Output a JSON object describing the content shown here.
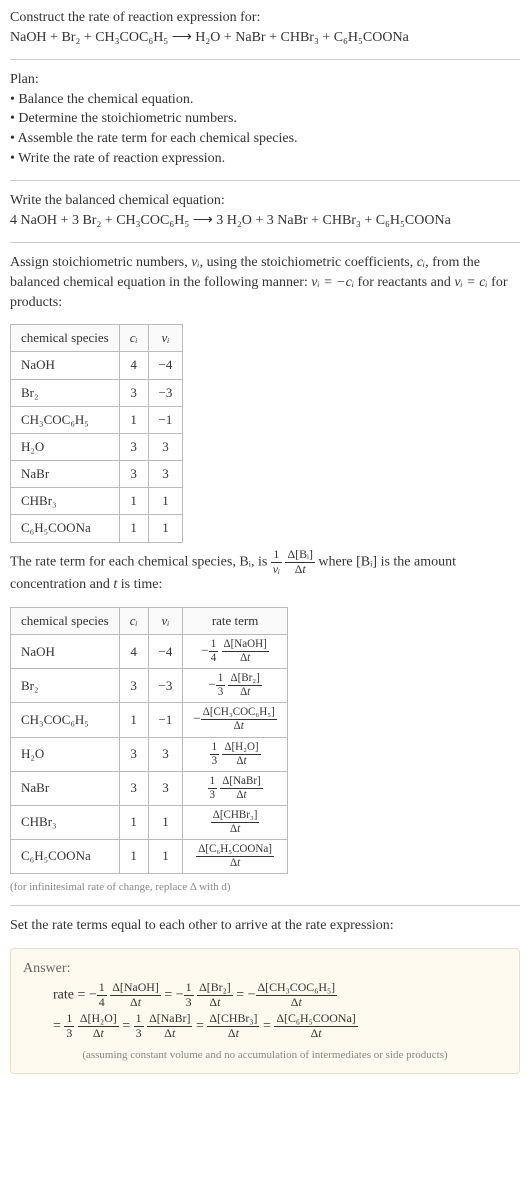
{
  "header": {
    "title": "Construct the rate of reaction expression for:",
    "equation": "NaOH + Br₂ + CH₃COC₆H₅  ⟶  H₂O + NaBr + CHBr₃ + C₆H₅COONa"
  },
  "plan": {
    "title": "Plan:",
    "steps": [
      "Balance the chemical equation.",
      "Determine the stoichiometric numbers.",
      "Assemble the rate term for each chemical species.",
      "Write the rate of reaction expression."
    ]
  },
  "balanced": {
    "title": "Write the balanced chemical equation:",
    "equation": "4 NaOH + 3 Br₂ + CH₃COC₆H₅  ⟶  3 H₂O + 3 NaBr + CHBr₃ + C₆H₅COONa"
  },
  "assign": {
    "intro_a": "Assign stoichiometric numbers, ",
    "nu_i": "νᵢ",
    "intro_b": ", using the stoichiometric coefficients, ",
    "c_i": "cᵢ",
    "intro_c": ", from the balanced chemical equation in the following manner: ",
    "rel1": "νᵢ = −cᵢ",
    "intro_d": " for reactants and ",
    "rel2": "νᵢ = cᵢ",
    "intro_e": " for products:"
  },
  "table1": {
    "headers": [
      "chemical species",
      "cᵢ",
      "νᵢ"
    ],
    "rows": [
      {
        "species": "NaOH",
        "c": "4",
        "nu": "−4"
      },
      {
        "species": "Br₂",
        "c": "3",
        "nu": "−3"
      },
      {
        "species": "CH₃COC₆H₅",
        "c": "1",
        "nu": "−1"
      },
      {
        "species": "H₂O",
        "c": "3",
        "nu": "3"
      },
      {
        "species": "NaBr",
        "c": "3",
        "nu": "3"
      },
      {
        "species": "CHBr₃",
        "c": "1",
        "nu": "1"
      },
      {
        "species": "C₆H₅COONa",
        "c": "1",
        "nu": "1"
      }
    ]
  },
  "rate_term": {
    "a": "The rate term for each chemical species, Bᵢ, is ",
    "b": " where [Bᵢ] is the amount concentration and ",
    "t": "t",
    "c": " is time:"
  },
  "table2": {
    "headers": [
      "chemical species",
      "cᵢ",
      "νᵢ",
      "rate term"
    ],
    "rows": [
      {
        "species": "NaOH",
        "c": "4",
        "nu": "−4",
        "coef": "−",
        "fnum": "1",
        "fden": "4",
        "dnum": "Δ[NaOH]",
        "dden": "Δt"
      },
      {
        "species": "Br₂",
        "c": "3",
        "nu": "−3",
        "coef": "−",
        "fnum": "1",
        "fden": "3",
        "dnum": "Δ[Br₂]",
        "dden": "Δt"
      },
      {
        "species": "CH₃COC₆H₅",
        "c": "1",
        "nu": "−1",
        "coef": "−",
        "fnum": "",
        "fden": "",
        "dnum": "Δ[CH₃COC₆H₅]",
        "dden": "Δt"
      },
      {
        "species": "H₂O",
        "c": "3",
        "nu": "3",
        "coef": "",
        "fnum": "1",
        "fden": "3",
        "dnum": "Δ[H₂O]",
        "dden": "Δt"
      },
      {
        "species": "NaBr",
        "c": "3",
        "nu": "3",
        "coef": "",
        "fnum": "1",
        "fden": "3",
        "dnum": "Δ[NaBr]",
        "dden": "Δt"
      },
      {
        "species": "CHBr₃",
        "c": "1",
        "nu": "1",
        "coef": "",
        "fnum": "",
        "fden": "",
        "dnum": "Δ[CHBr₃]",
        "dden": "Δt"
      },
      {
        "species": "C₆H₅COONa",
        "c": "1",
        "nu": "1",
        "coef": "",
        "fnum": "",
        "fden": "",
        "dnum": "Δ[C₆H₅COONa]",
        "dden": "Δt"
      }
    ]
  },
  "note": "(for infinitesimal rate of change, replace Δ with d)",
  "set_equal": "Set the rate terms equal to each other to arrive at the rate expression:",
  "answer": {
    "label": "Answer:",
    "line1_prefix": "rate = ",
    "assumption": "(assuming constant volume and no accumulation of intermediates or side products)"
  },
  "chart_data": {
    "type": "table",
    "title": "Stoichiometric numbers and rate terms",
    "tables": [
      {
        "columns": [
          "chemical species",
          "c_i",
          "nu_i"
        ],
        "rows": [
          [
            "NaOH",
            4,
            -4
          ],
          [
            "Br2",
            3,
            -3
          ],
          [
            "CH3COC6H5",
            1,
            -1
          ],
          [
            "H2O",
            3,
            3
          ],
          [
            "NaBr",
            3,
            3
          ],
          [
            "CHBr3",
            1,
            1
          ],
          [
            "C6H5COONa",
            1,
            1
          ]
        ]
      },
      {
        "columns": [
          "chemical species",
          "c_i",
          "nu_i",
          "rate term"
        ],
        "rows": [
          [
            "NaOH",
            4,
            -4,
            "-(1/4) Δ[NaOH]/Δt"
          ],
          [
            "Br2",
            3,
            -3,
            "-(1/3) Δ[Br2]/Δt"
          ],
          [
            "CH3COC6H5",
            1,
            -1,
            "- Δ[CH3COC6H5]/Δt"
          ],
          [
            "H2O",
            3,
            3,
            "(1/3) Δ[H2O]/Δt"
          ],
          [
            "NaBr",
            3,
            3,
            "(1/3) Δ[NaBr]/Δt"
          ],
          [
            "CHBr3",
            1,
            1,
            "Δ[CHBr3]/Δt"
          ],
          [
            "C6H5COONa",
            1,
            1,
            "Δ[C6H5COONa]/Δt"
          ]
        ]
      }
    ],
    "rate_expression": "rate = -(1/4) Δ[NaOH]/Δt = -(1/3) Δ[Br2]/Δt = - Δ[CH3COC6H5]/Δt = (1/3) Δ[H2O]/Δt = (1/3) Δ[NaBr]/Δt = Δ[CHBr3]/Δt = Δ[C6H5COONa]/Δt"
  }
}
